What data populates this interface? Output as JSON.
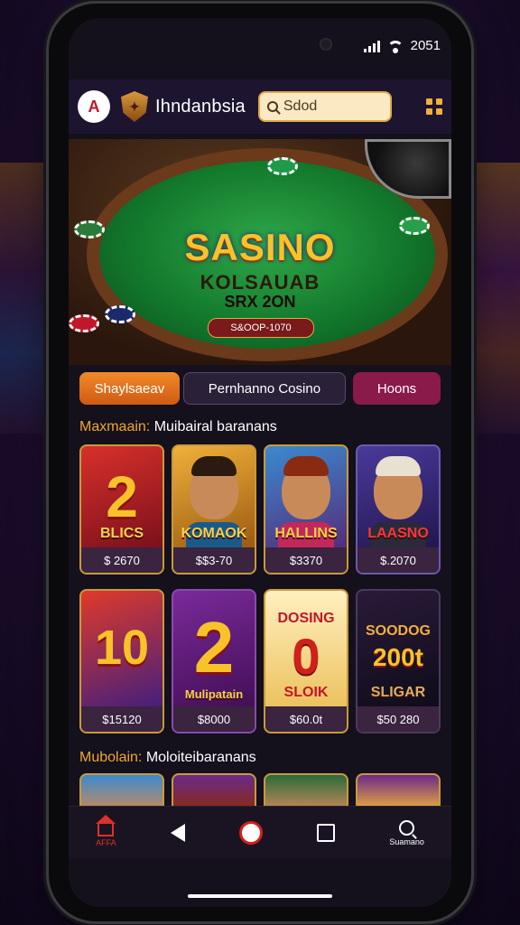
{
  "status_bar": {
    "time": "2051"
  },
  "header": {
    "logo_glyph": "A",
    "brand": "Ihndanbsia",
    "search_placeholder": "Sdod"
  },
  "hero": {
    "title": "SASINO",
    "subtitle": "KOLSAUAB",
    "subtitle2": "SRX 2ON",
    "pill": "S&OOP-1070"
  },
  "tabs": [
    {
      "label": "Shaylsaeav"
    },
    {
      "label": "Pernhanno Cosino"
    },
    {
      "label": "Hoons"
    }
  ],
  "sections": [
    {
      "highlight": "Maxmaain:",
      "rest": " Muibairal baranans"
    },
    {
      "highlight": "Mubolain:",
      "rest": " Moloiteibaranans"
    }
  ],
  "row1": [
    {
      "big": "2",
      "label": "BLICS",
      "price": "$ 2670"
    },
    {
      "big": "",
      "label": "KOMAOK",
      "price": "$$3-70"
    },
    {
      "big": "",
      "label": "HALLINS",
      "price": "$3370"
    },
    {
      "big": "",
      "label": "LAASNO",
      "price": "$.2070"
    }
  ],
  "row2": [
    {
      "big": "10",
      "label": "",
      "price": "$15120"
    },
    {
      "big": "2",
      "label": "Mulipatain",
      "price": "$8000"
    },
    {
      "big": "0",
      "label": "SLOIK",
      "price": "$60.0t"
    },
    {
      "big": "",
      "label": "SLIGAR",
      "price": "$50 280"
    }
  ],
  "row2_extra": {
    "card3_top": "DOSING",
    "card4_top": "SOODOG",
    "card4_mid": "200t"
  },
  "bottom_nav": [
    {
      "label": "AFFA"
    },
    {
      "label": ""
    },
    {
      "label": ""
    },
    {
      "label": ""
    },
    {
      "label": "Suamano"
    }
  ],
  "colors": {
    "accent": "#f0a82a",
    "tab_active": "#e0702a",
    "tab_hot": "#8a1a4a"
  }
}
